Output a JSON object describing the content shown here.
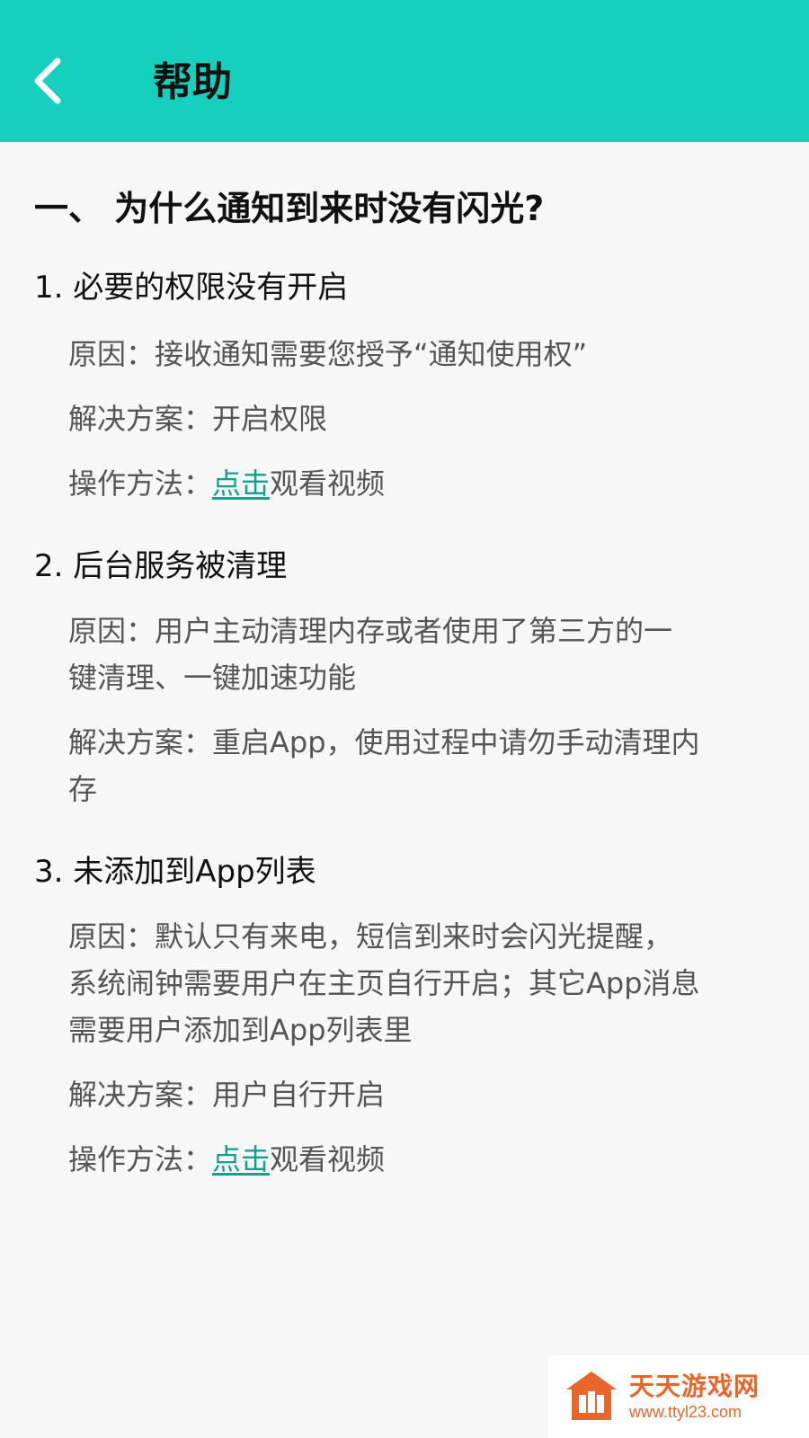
{
  "header": {
    "title": "帮助",
    "back_icon": "chevron-left-icon",
    "background_color": "#14d0bd"
  },
  "section": {
    "heading": "一、 为什么通知到来时没有闪光?",
    "items": [
      {
        "title": "1. 必要的权限没有开启",
        "reason_label": "原因：",
        "reason": "接收通知需要您授予“通知使用权”",
        "solution_label": "解决方案：",
        "solution": "开启权限",
        "method_label": "操作方法：",
        "method_link": "点击",
        "method_suffix": "观看视频"
      },
      {
        "title": "2. 后台服务被清理",
        "reason_line1": "原因：用户主动清理内存或者使用了第三方的一",
        "reason_line2": "键清理、一键加速功能",
        "solution_line1": "解决方案：重启App，使用过程中请勿手动清理内",
        "solution_line2": "存"
      },
      {
        "title": "3. 未添加到App列表",
        "reason_line1": "原因：默认只有来电，短信到来时会闪光提醒，",
        "reason_line2": "系统闹钟需要用户在主页自行开启；其它App消息",
        "reason_line3": "需要用户添加到App列表里",
        "solution_label": "解决方案：",
        "solution": "用户自行开启",
        "method_label": "操作方法：",
        "method_link": "点击",
        "method_suffix": "观看视频"
      }
    ],
    "link_color": "#14a08e"
  },
  "watermark": {
    "name": "天天游戏网",
    "url": "www.ttyl23.com",
    "color": "#e7672b"
  }
}
